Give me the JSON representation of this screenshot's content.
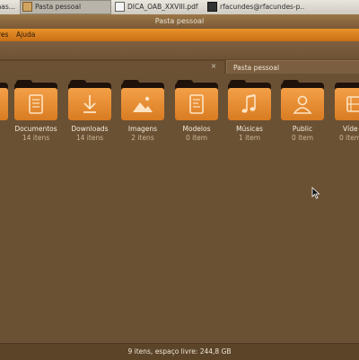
{
  "taskbar": {
    "tasks": [
      {
        "label": "mas...",
        "icon": "app-icon"
      },
      {
        "label": "Pasta pessoal",
        "icon": "folder-icon"
      },
      {
        "label": "DICA_OAB_XXVIII.pdf",
        "icon": "document-icon"
      },
      {
        "label": "rfacundes@rfacundes-p...",
        "icon": "terminal-icon"
      }
    ]
  },
  "window": {
    "title": "Pasta pessoal",
    "menu": [
      "res",
      "Ajuda"
    ],
    "tab_label": "Pasta pessoal",
    "tab_close": "×"
  },
  "folders": [
    {
      "name": "Documentos",
      "count": "14 itens",
      "icon": "document-icon"
    },
    {
      "name": "Downloads",
      "count": "14 itens",
      "icon": "download-icon"
    },
    {
      "name": "Imagens",
      "count": "2 itens",
      "icon": "image-icon"
    },
    {
      "name": "Modelos",
      "count": "0 item",
      "icon": "template-icon"
    },
    {
      "name": "Músicas",
      "count": "1 item",
      "icon": "music-icon"
    },
    {
      "name": "Public",
      "count": "0 item",
      "icon": "person-icon"
    },
    {
      "name": "Víde",
      "count": "0 item",
      "icon": "video-icon"
    }
  ],
  "status": {
    "text": "9 itens, espaço livre: 244,8 GB"
  },
  "colors": {
    "accent": "#e9912a",
    "background": "#6b5134",
    "folder": "#f0963a"
  }
}
